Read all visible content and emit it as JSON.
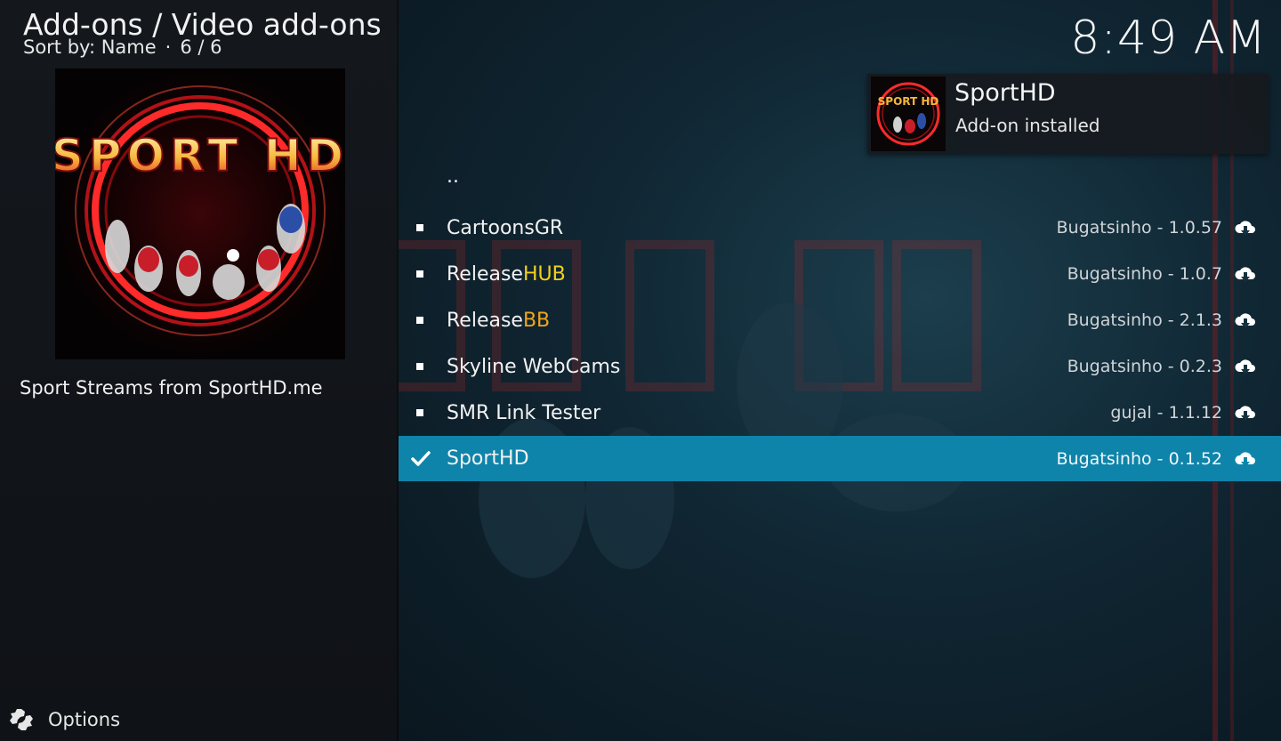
{
  "header": {
    "title": "Add-ons / Video add-ons",
    "sort_by": "Sort by: Name",
    "separator": "·",
    "count": "6 / 6"
  },
  "clock": "8:49 AM",
  "selected_addon": {
    "logo_text": "SPORT HD",
    "description": "Sport Streams from SportHD.me"
  },
  "notification": {
    "title": "SportHD",
    "message": "Add-on installed",
    "icon": "sporthd-logo-icon"
  },
  "list": {
    "parent_label": "..",
    "items": [
      {
        "name": "CartoonsGR",
        "name_prefix": "CartoonsGR",
        "name_highlight": "",
        "author_version": "Bugatsinho - 1.0.57",
        "status_icon": "cloud-download-icon",
        "selected": false
      },
      {
        "name": "ReleaseHUB",
        "name_prefix": "Release",
        "name_highlight": "HUB",
        "highlight_color": "#f4d11b",
        "author_version": "Bugatsinho - 1.0.7",
        "status_icon": "cloud-download-icon",
        "selected": false
      },
      {
        "name": "ReleaseBB",
        "name_prefix": "Release",
        "name_highlight": "BB",
        "highlight_color": "#f2a51a",
        "author_version": "Bugatsinho - 2.1.3",
        "status_icon": "cloud-download-icon",
        "selected": false
      },
      {
        "name": "Skyline WebCams",
        "name_prefix": "Skyline WebCams",
        "name_highlight": "",
        "author_version": "Bugatsinho - 0.2.3",
        "status_icon": "cloud-download-icon",
        "selected": false
      },
      {
        "name": "SMR Link Tester",
        "name_prefix": "SMR Link Tester",
        "name_highlight": "",
        "author_version": "gujal - 1.1.12",
        "status_icon": "cloud-download-icon",
        "selected": false
      },
      {
        "name": "SportHD",
        "name_prefix": "SportHD",
        "name_highlight": "",
        "author_version": "Bugatsinho - 0.1.52",
        "status_icon": "cloud-download-icon",
        "selected": true
      }
    ]
  },
  "footer": {
    "options_label": "Options",
    "options_icon": "options-gear-icon"
  },
  "colors": {
    "selection": "#0f84aa",
    "highlight_hub": "#f4d11b",
    "highlight_bb": "#f2a51a"
  }
}
